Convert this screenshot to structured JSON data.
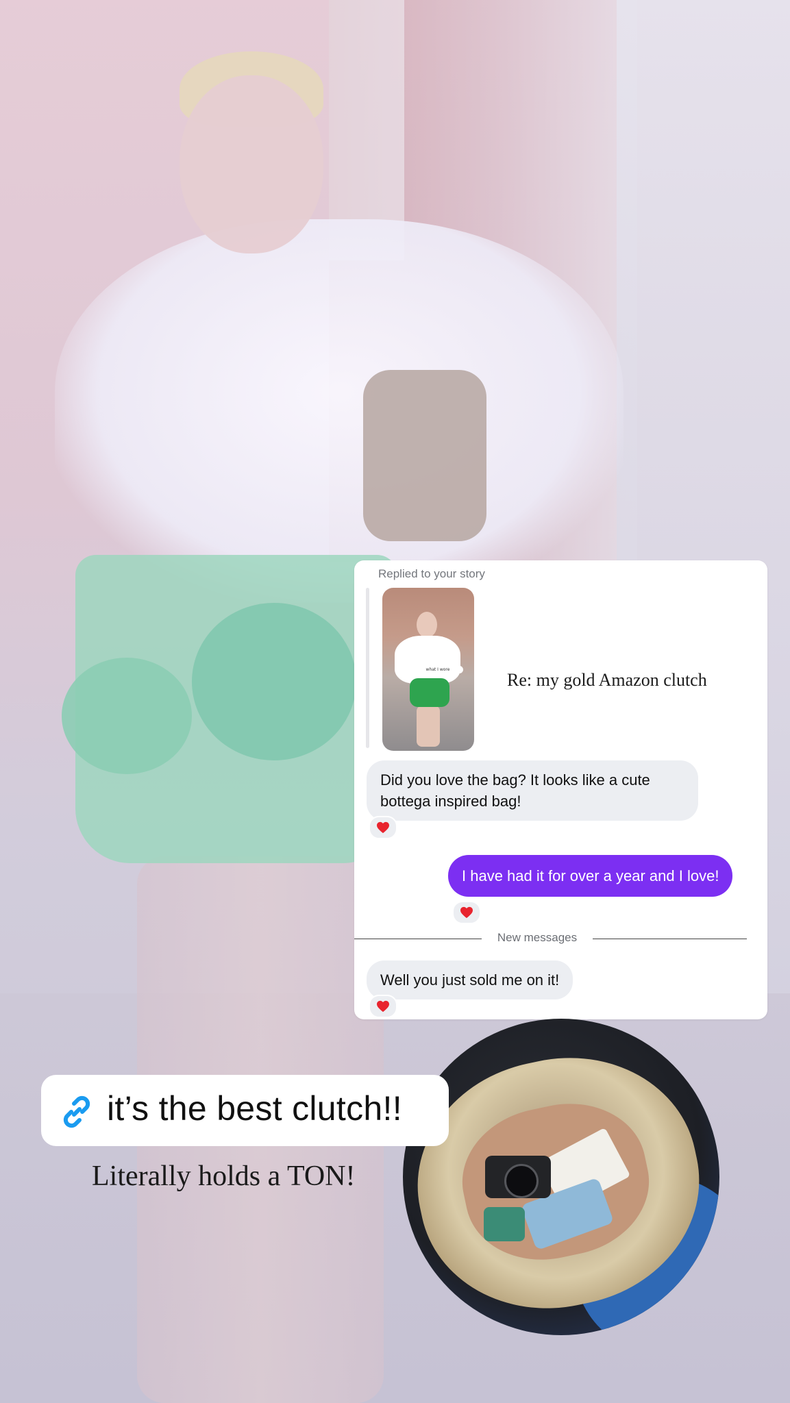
{
  "story_reply": {
    "replied_label": "Replied to your story",
    "story_caption": "Re: my gold Amazon clutch",
    "thumb_sticker": "what I wore"
  },
  "messages": [
    {
      "direction": "incoming",
      "text": "Did you love the bag? It looks like a cute bottega inspired bag!",
      "reaction": "heart"
    },
    {
      "direction": "outgoing",
      "text": "I have had it for over a year and I love!",
      "reaction": "heart"
    },
    {
      "direction": "incoming",
      "text": "Well you just sold me on it!",
      "reaction": "heart"
    }
  ],
  "divider_label": "New messages",
  "link_sticker": {
    "text": "it’s the best clutch!!",
    "icon": "link-icon"
  },
  "caption": "Literally holds a TON!",
  "colors": {
    "outgoing_bubble": "#7c2ff2",
    "incoming_bubble": "#eceef2",
    "link_icon": "#1a9bf0",
    "reaction_heart": "#e8242e"
  }
}
